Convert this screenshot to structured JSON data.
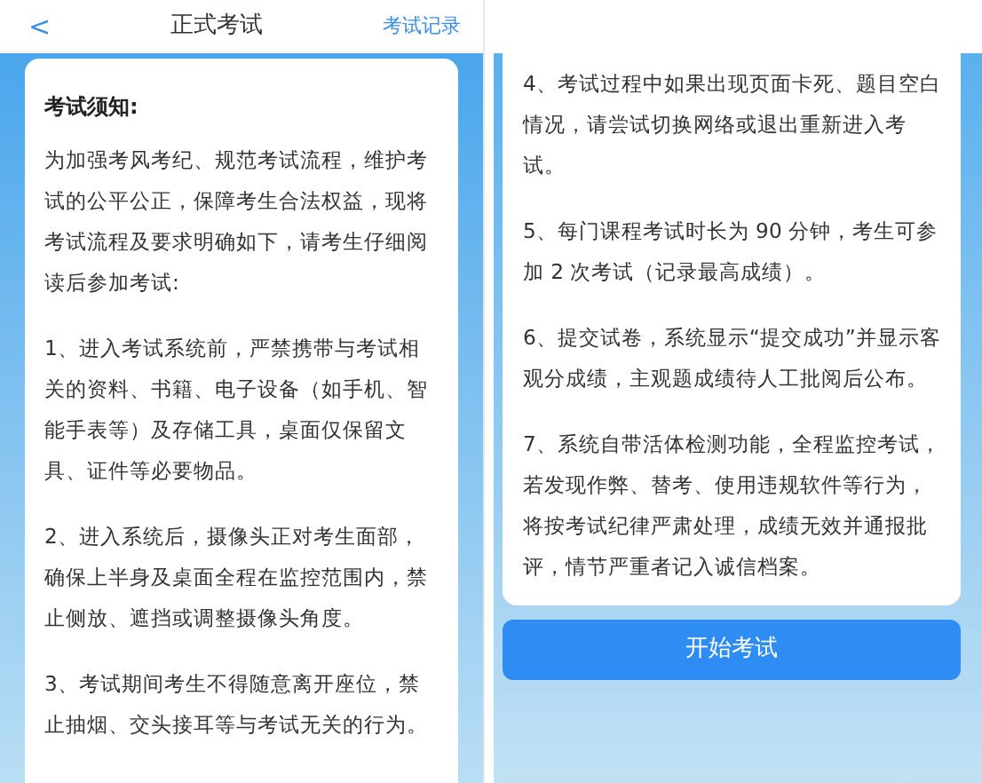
{
  "left_screen": {
    "header": {
      "back": "<",
      "title": "正式考试",
      "action": "考试记录"
    },
    "notice": {
      "title": "考试须知:",
      "paragraphs": [
        "为加强考风考纪、规范考试流程，维护考试的公平公正，保障考生合法权益，现将考试流程及要求明确如下，请考生仔细阅读后参加考试:",
        "1、进入考试系统前，严禁携带与考试相关的资料、书籍、电子设备（如手机、智能手表等）及存储工具，桌面仅保留文具、证件等必要物品。",
        "2、进入系统后，摄像头正对考生面部，确保上半身及桌面全程在监控范围内，禁止侧放、遮挡或调整摄像头角度。",
        "3、考试期间考生不得随意离开座位，禁止抽烟、交头接耳等与考试无关的行为。"
      ]
    }
  },
  "right_screen": {
    "paragraphs": [
      "4、考试过程中如果出现页面卡死、题目空白情况，请尝试切换网络或退出重新进入考试。",
      "5、每门课程考试时长为 90 分钟，考生可参加 2 次考试（记录最高成绩）。",
      "6、提交试卷，系统显示“提交成功”并显示客观分成绩，主观题成绩待人工批阅后公布。",
      "7、系统自带活体检测功能，全程监控考试，若发现作弊、替考、使用违规软件等行为，将按考试纪律严肃处理，成绩无效并通报批评，情节严重者记入诚信档案。"
    ],
    "button": "开始考试"
  }
}
